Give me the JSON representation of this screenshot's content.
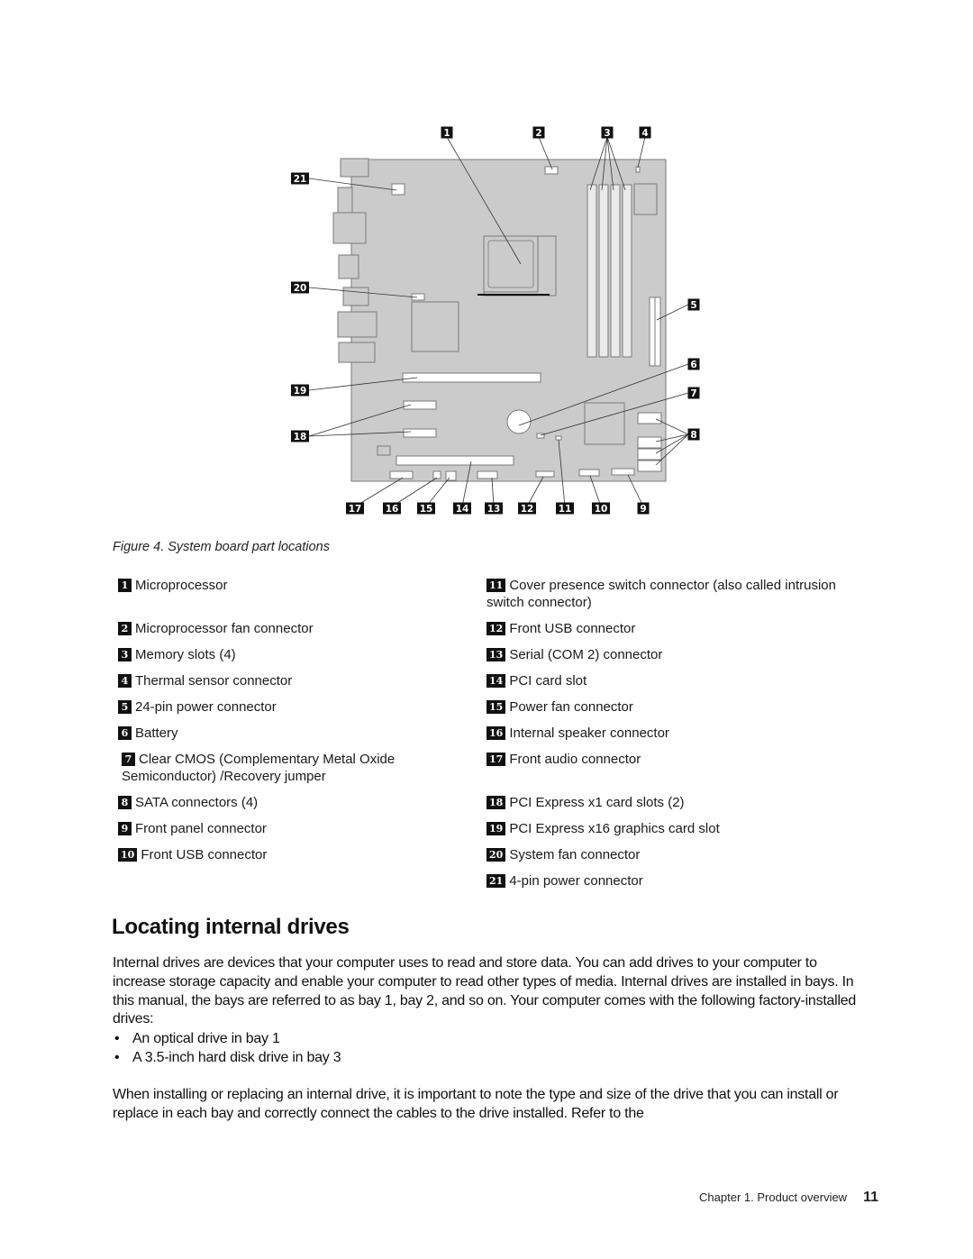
{
  "figure": {
    "caption": "Figure 4.  System board part locations",
    "callouts_top": [
      "1",
      "2",
      "3",
      "4"
    ],
    "callouts_right": [
      "5",
      "6",
      "7",
      "8"
    ],
    "callouts_left": [
      "21",
      "20",
      "19",
      "18"
    ],
    "callouts_bottom": [
      "17",
      "16",
      "15",
      "14",
      "13",
      "12",
      "11",
      "10",
      "9"
    ],
    "colors": {
      "board": "#cbcbcb",
      "outline": "#7a7a7a",
      "callout_bg": "#111111"
    }
  },
  "legend": {
    "left": [
      {
        "num": "1",
        "label": "Microprocessor"
      },
      {
        "num": "2",
        "label": "Microprocessor fan connector"
      },
      {
        "num": "3",
        "label": "Memory slots (4)"
      },
      {
        "num": "4",
        "label": "Thermal sensor connector"
      },
      {
        "num": "5",
        "label": "24-pin power connector"
      },
      {
        "num": "6",
        "label": "Battery"
      },
      {
        "num": "7",
        "label": "Clear CMOS (Complementary Metal Oxide Semiconductor) /Recovery jumper"
      },
      {
        "num": "8",
        "label": "SATA connectors (4)"
      },
      {
        "num": "9",
        "label": "Front panel connector"
      },
      {
        "num": "10",
        "label": "Front USB connector"
      }
    ],
    "right": [
      {
        "num": "11",
        "label": "Cover presence switch connector (also called intrusion switch connector)"
      },
      {
        "num": "12",
        "label": "Front USB connector"
      },
      {
        "num": "13",
        "label": "Serial (COM 2) connector"
      },
      {
        "num": "14",
        "label": "PCI card slot"
      },
      {
        "num": "15",
        "label": "Power fan connector"
      },
      {
        "num": "16",
        "label": "Internal speaker connector"
      },
      {
        "num": "17",
        "label": "Front audio connector"
      },
      {
        "num": "18",
        "label": "PCI Express x1 card slots (2)"
      },
      {
        "num": "19",
        "label": "PCI Express x16 graphics card slot"
      },
      {
        "num": "20",
        "label": "System fan connector"
      },
      {
        "num": "21",
        "label": "4-pin power connector"
      }
    ]
  },
  "section": {
    "title": "Locating internal drives",
    "intro": "Internal drives are devices that your computer uses to read and store data.  You can add drives to your computer to increase storage capacity and enable your computer to read other types of media.  Internal drives are installed in bays.  In this manual, the bays are referred to as bay 1, bay 2, and so on.  Your computer comes with the following factory-installed drives:",
    "bullets": [
      "An optical drive in bay 1",
      "A 3.5-inch hard disk drive in bay 3"
    ],
    "bullet_glyph": "•",
    "outro": "When installing or replacing an internal drive, it is important to note the type and size of the drive that you can install or replace in each bay and correctly connect the cables to the drive installed.  Refer to the"
  },
  "footer": {
    "chapter": "Chapter 1.  Product overview",
    "page": "11"
  }
}
